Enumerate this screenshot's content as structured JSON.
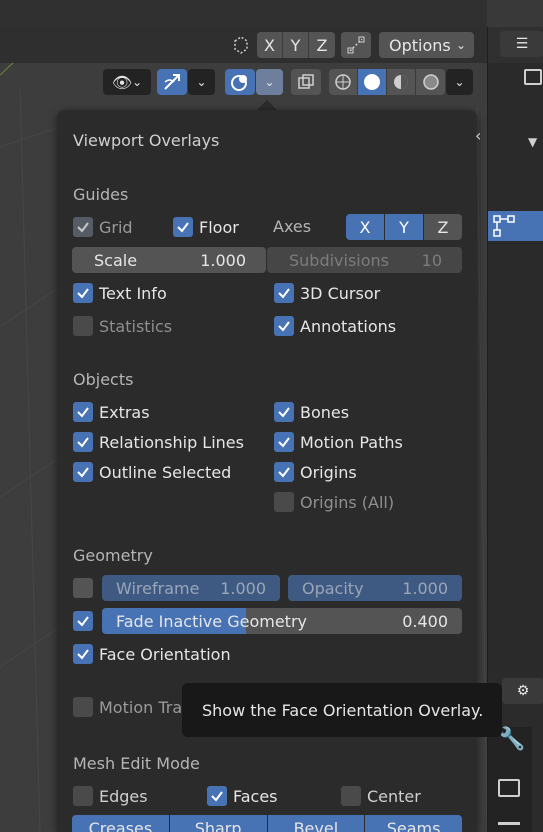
{
  "header": {
    "mirror_axes": [
      "X",
      "Y",
      "Z"
    ],
    "options_label": "Options"
  },
  "overlays": {
    "title": "Viewport Overlays",
    "guides": {
      "section": "Guides",
      "grid": "Grid",
      "floor": "Floor",
      "axes_label": "Axes",
      "axes": [
        "X",
        "Y",
        "Z"
      ],
      "scale_label": "Scale",
      "scale_value": "1.000",
      "subdivisions_label": "Subdivisions",
      "subdivisions_value": "10",
      "text_info": "Text Info",
      "cursor_3d": "3D Cursor",
      "statistics": "Statistics",
      "annotations": "Annotations"
    },
    "objects": {
      "section": "Objects",
      "extras": "Extras",
      "bones": "Bones",
      "relationship_lines": "Relationship Lines",
      "motion_paths": "Motion Paths",
      "outline_selected": "Outline Selected",
      "origins": "Origins",
      "origins_all": "Origins (All)"
    },
    "geometry": {
      "section": "Geometry",
      "wireframe_label": "Wireframe",
      "wireframe_value": "1.000",
      "opacity_label": "Opacity",
      "opacity_value": "1.000",
      "fade_label": "Fade Inactive Geometry",
      "fade_value": "0.400",
      "fade_fraction": 0.4,
      "face_orientation": "Face Orientation",
      "motion_tracking": "Motion Tra"
    },
    "mesh_edit": {
      "section": "Mesh Edit Mode",
      "edges": "Edges",
      "faces": "Faces",
      "center": "Center",
      "buttons": [
        "Creases",
        "Sharp",
        "Bevel",
        "Seams"
      ]
    }
  },
  "tooltip": {
    "text": "Show the Face Orientation Overlay."
  },
  "colors": {
    "accent": "#4772b3",
    "panel_bg": "#2b2b2b",
    "widget": "#545454",
    "tooltip_bg": "#181818"
  }
}
